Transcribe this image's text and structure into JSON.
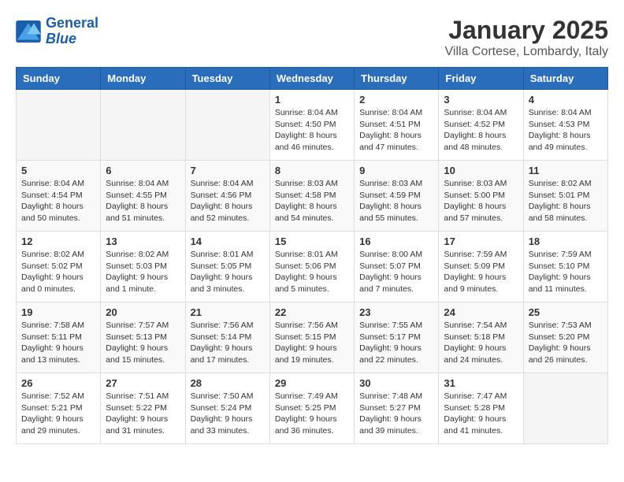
{
  "header": {
    "logo_line1": "General",
    "logo_line2": "Blue",
    "month": "January 2025",
    "location": "Villa Cortese, Lombardy, Italy"
  },
  "weekdays": [
    "Sunday",
    "Monday",
    "Tuesday",
    "Wednesday",
    "Thursday",
    "Friday",
    "Saturday"
  ],
  "weeks": [
    [
      {
        "day": "",
        "info": ""
      },
      {
        "day": "",
        "info": ""
      },
      {
        "day": "",
        "info": ""
      },
      {
        "day": "1",
        "info": "Sunrise: 8:04 AM\nSunset: 4:50 PM\nDaylight: 8 hours\nand 46 minutes."
      },
      {
        "day": "2",
        "info": "Sunrise: 8:04 AM\nSunset: 4:51 PM\nDaylight: 8 hours\nand 47 minutes."
      },
      {
        "day": "3",
        "info": "Sunrise: 8:04 AM\nSunset: 4:52 PM\nDaylight: 8 hours\nand 48 minutes."
      },
      {
        "day": "4",
        "info": "Sunrise: 8:04 AM\nSunset: 4:53 PM\nDaylight: 8 hours\nand 49 minutes."
      }
    ],
    [
      {
        "day": "5",
        "info": "Sunrise: 8:04 AM\nSunset: 4:54 PM\nDaylight: 8 hours\nand 50 minutes."
      },
      {
        "day": "6",
        "info": "Sunrise: 8:04 AM\nSunset: 4:55 PM\nDaylight: 8 hours\nand 51 minutes."
      },
      {
        "day": "7",
        "info": "Sunrise: 8:04 AM\nSunset: 4:56 PM\nDaylight: 8 hours\nand 52 minutes."
      },
      {
        "day": "8",
        "info": "Sunrise: 8:03 AM\nSunset: 4:58 PM\nDaylight: 8 hours\nand 54 minutes."
      },
      {
        "day": "9",
        "info": "Sunrise: 8:03 AM\nSunset: 4:59 PM\nDaylight: 8 hours\nand 55 minutes."
      },
      {
        "day": "10",
        "info": "Sunrise: 8:03 AM\nSunset: 5:00 PM\nDaylight: 8 hours\nand 57 minutes."
      },
      {
        "day": "11",
        "info": "Sunrise: 8:02 AM\nSunset: 5:01 PM\nDaylight: 8 hours\nand 58 minutes."
      }
    ],
    [
      {
        "day": "12",
        "info": "Sunrise: 8:02 AM\nSunset: 5:02 PM\nDaylight: 9 hours\nand 0 minutes."
      },
      {
        "day": "13",
        "info": "Sunrise: 8:02 AM\nSunset: 5:03 PM\nDaylight: 9 hours\nand 1 minute."
      },
      {
        "day": "14",
        "info": "Sunrise: 8:01 AM\nSunset: 5:05 PM\nDaylight: 9 hours\nand 3 minutes."
      },
      {
        "day": "15",
        "info": "Sunrise: 8:01 AM\nSunset: 5:06 PM\nDaylight: 9 hours\nand 5 minutes."
      },
      {
        "day": "16",
        "info": "Sunrise: 8:00 AM\nSunset: 5:07 PM\nDaylight: 9 hours\nand 7 minutes."
      },
      {
        "day": "17",
        "info": "Sunrise: 7:59 AM\nSunset: 5:09 PM\nDaylight: 9 hours\nand 9 minutes."
      },
      {
        "day": "18",
        "info": "Sunrise: 7:59 AM\nSunset: 5:10 PM\nDaylight: 9 hours\nand 11 minutes."
      }
    ],
    [
      {
        "day": "19",
        "info": "Sunrise: 7:58 AM\nSunset: 5:11 PM\nDaylight: 9 hours\nand 13 minutes."
      },
      {
        "day": "20",
        "info": "Sunrise: 7:57 AM\nSunset: 5:13 PM\nDaylight: 9 hours\nand 15 minutes."
      },
      {
        "day": "21",
        "info": "Sunrise: 7:56 AM\nSunset: 5:14 PM\nDaylight: 9 hours\nand 17 minutes."
      },
      {
        "day": "22",
        "info": "Sunrise: 7:56 AM\nSunset: 5:15 PM\nDaylight: 9 hours\nand 19 minutes."
      },
      {
        "day": "23",
        "info": "Sunrise: 7:55 AM\nSunset: 5:17 PM\nDaylight: 9 hours\nand 22 minutes."
      },
      {
        "day": "24",
        "info": "Sunrise: 7:54 AM\nSunset: 5:18 PM\nDaylight: 9 hours\nand 24 minutes."
      },
      {
        "day": "25",
        "info": "Sunrise: 7:53 AM\nSunset: 5:20 PM\nDaylight: 9 hours\nand 26 minutes."
      }
    ],
    [
      {
        "day": "26",
        "info": "Sunrise: 7:52 AM\nSunset: 5:21 PM\nDaylight: 9 hours\nand 29 minutes."
      },
      {
        "day": "27",
        "info": "Sunrise: 7:51 AM\nSunset: 5:22 PM\nDaylight: 9 hours\nand 31 minutes."
      },
      {
        "day": "28",
        "info": "Sunrise: 7:50 AM\nSunset: 5:24 PM\nDaylight: 9 hours\nand 33 minutes."
      },
      {
        "day": "29",
        "info": "Sunrise: 7:49 AM\nSunset: 5:25 PM\nDaylight: 9 hours\nand 36 minutes."
      },
      {
        "day": "30",
        "info": "Sunrise: 7:48 AM\nSunset: 5:27 PM\nDaylight: 9 hours\nand 39 minutes."
      },
      {
        "day": "31",
        "info": "Sunrise: 7:47 AM\nSunset: 5:28 PM\nDaylight: 9 hours\nand 41 minutes."
      },
      {
        "day": "",
        "info": ""
      }
    ]
  ]
}
